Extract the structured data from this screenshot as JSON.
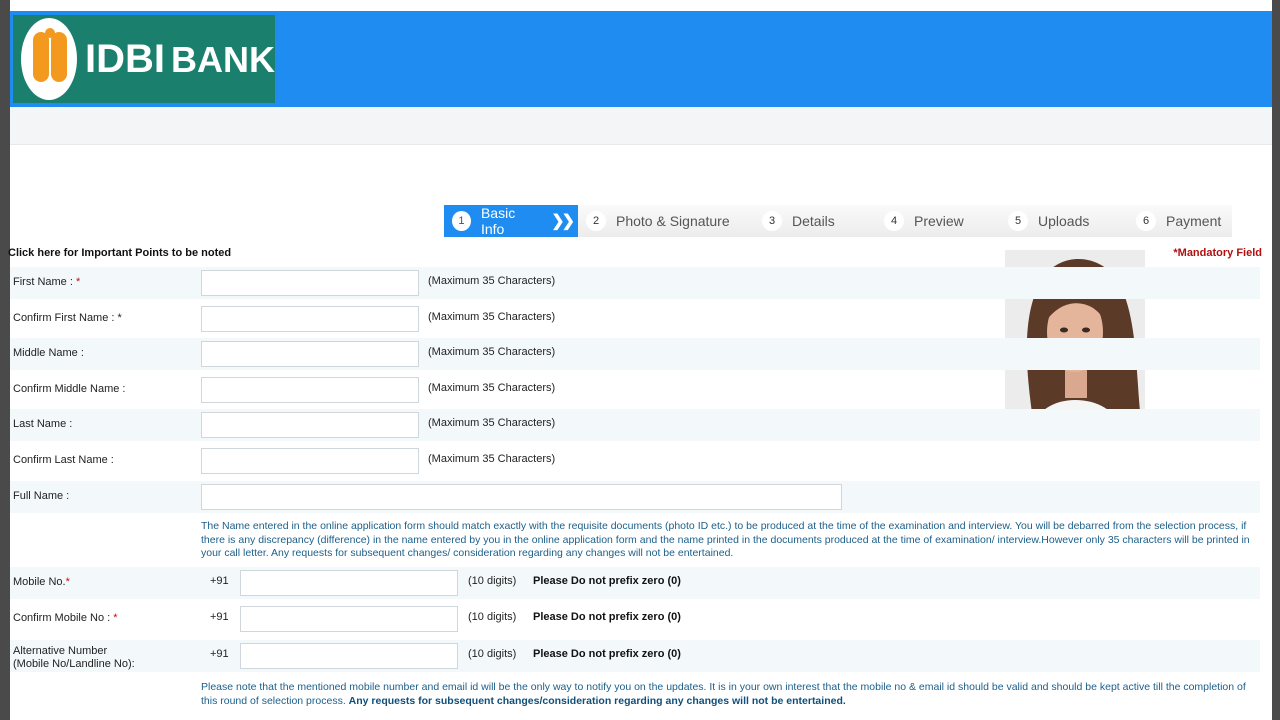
{
  "header": {
    "logo_text": "IDBI",
    "logo_text_2": "BANK"
  },
  "steps": [
    {
      "num": "1",
      "label": "Basic Info",
      "active": true
    },
    {
      "num": "2",
      "label": "Photo & Signature",
      "active": false
    },
    {
      "num": "3",
      "label": "Details",
      "active": false
    },
    {
      "num": "4",
      "label": "Preview",
      "active": false
    },
    {
      "num": "5",
      "label": "Uploads",
      "active": false
    },
    {
      "num": "6",
      "label": "Payment",
      "active": false
    }
  ],
  "important_link": "Click here for Important Points to be noted",
  "mandatory": "*Mandatory Field",
  "fields": {
    "first_name": {
      "label": "First Name : ",
      "req": "*",
      "hint": "(Maximum 35 Characters)"
    },
    "confirm_first_name": {
      "label": "Confirm First Name : ",
      "req": "*",
      "hint": "(Maximum 35 Characters)"
    },
    "middle_name": {
      "label": "Middle Name :",
      "hint": "(Maximum 35 Characters)"
    },
    "confirm_middle_name": {
      "label": "Confirm Middle Name :",
      "hint": "(Maximum 35 Characters)"
    },
    "last_name": {
      "label": "Last Name :",
      "hint": "(Maximum 35 Characters)"
    },
    "confirm_last_name": {
      "label": "Confirm Last Name :",
      "hint": "(Maximum 35 Characters)"
    },
    "full_name": {
      "label": "Full Name :"
    }
  },
  "name_note": "The Name entered in the online application form should match exactly with the requisite documents (photo ID etc.) to be produced at the time of the examination and interview. You will be debarred from the selection process, if there is any discrepancy (difference) in the name entered by you in the online application form and the name printed in the documents produced at the time of examination/ interview.However only 35 characters will be printed in your call letter. Any requests for subsequent changes/ consideration regarding any changes will not be entertained.",
  "mobile": {
    "mobile_label": "Mobile No.",
    "confirm_label": "Confirm Mobile No : ",
    "alt_label_1": "Alternative Number",
    "alt_label_2": "(Mobile No/Landline No):",
    "req": "*",
    "prefix": "+91",
    "digits": "(10 digits)",
    "no_zero": "Please Do not prefix zero (0)"
  },
  "contact_note": "Please note that the mentioned mobile number and email id will be the only way to notify you on the updates. It is in your own interest that the mobile no & email id should be valid and should be kept active till the completion of this round of selection process. ",
  "contact_note_bold": "Any requests for subsequent changes/consideration regarding any changes will not be entertained."
}
